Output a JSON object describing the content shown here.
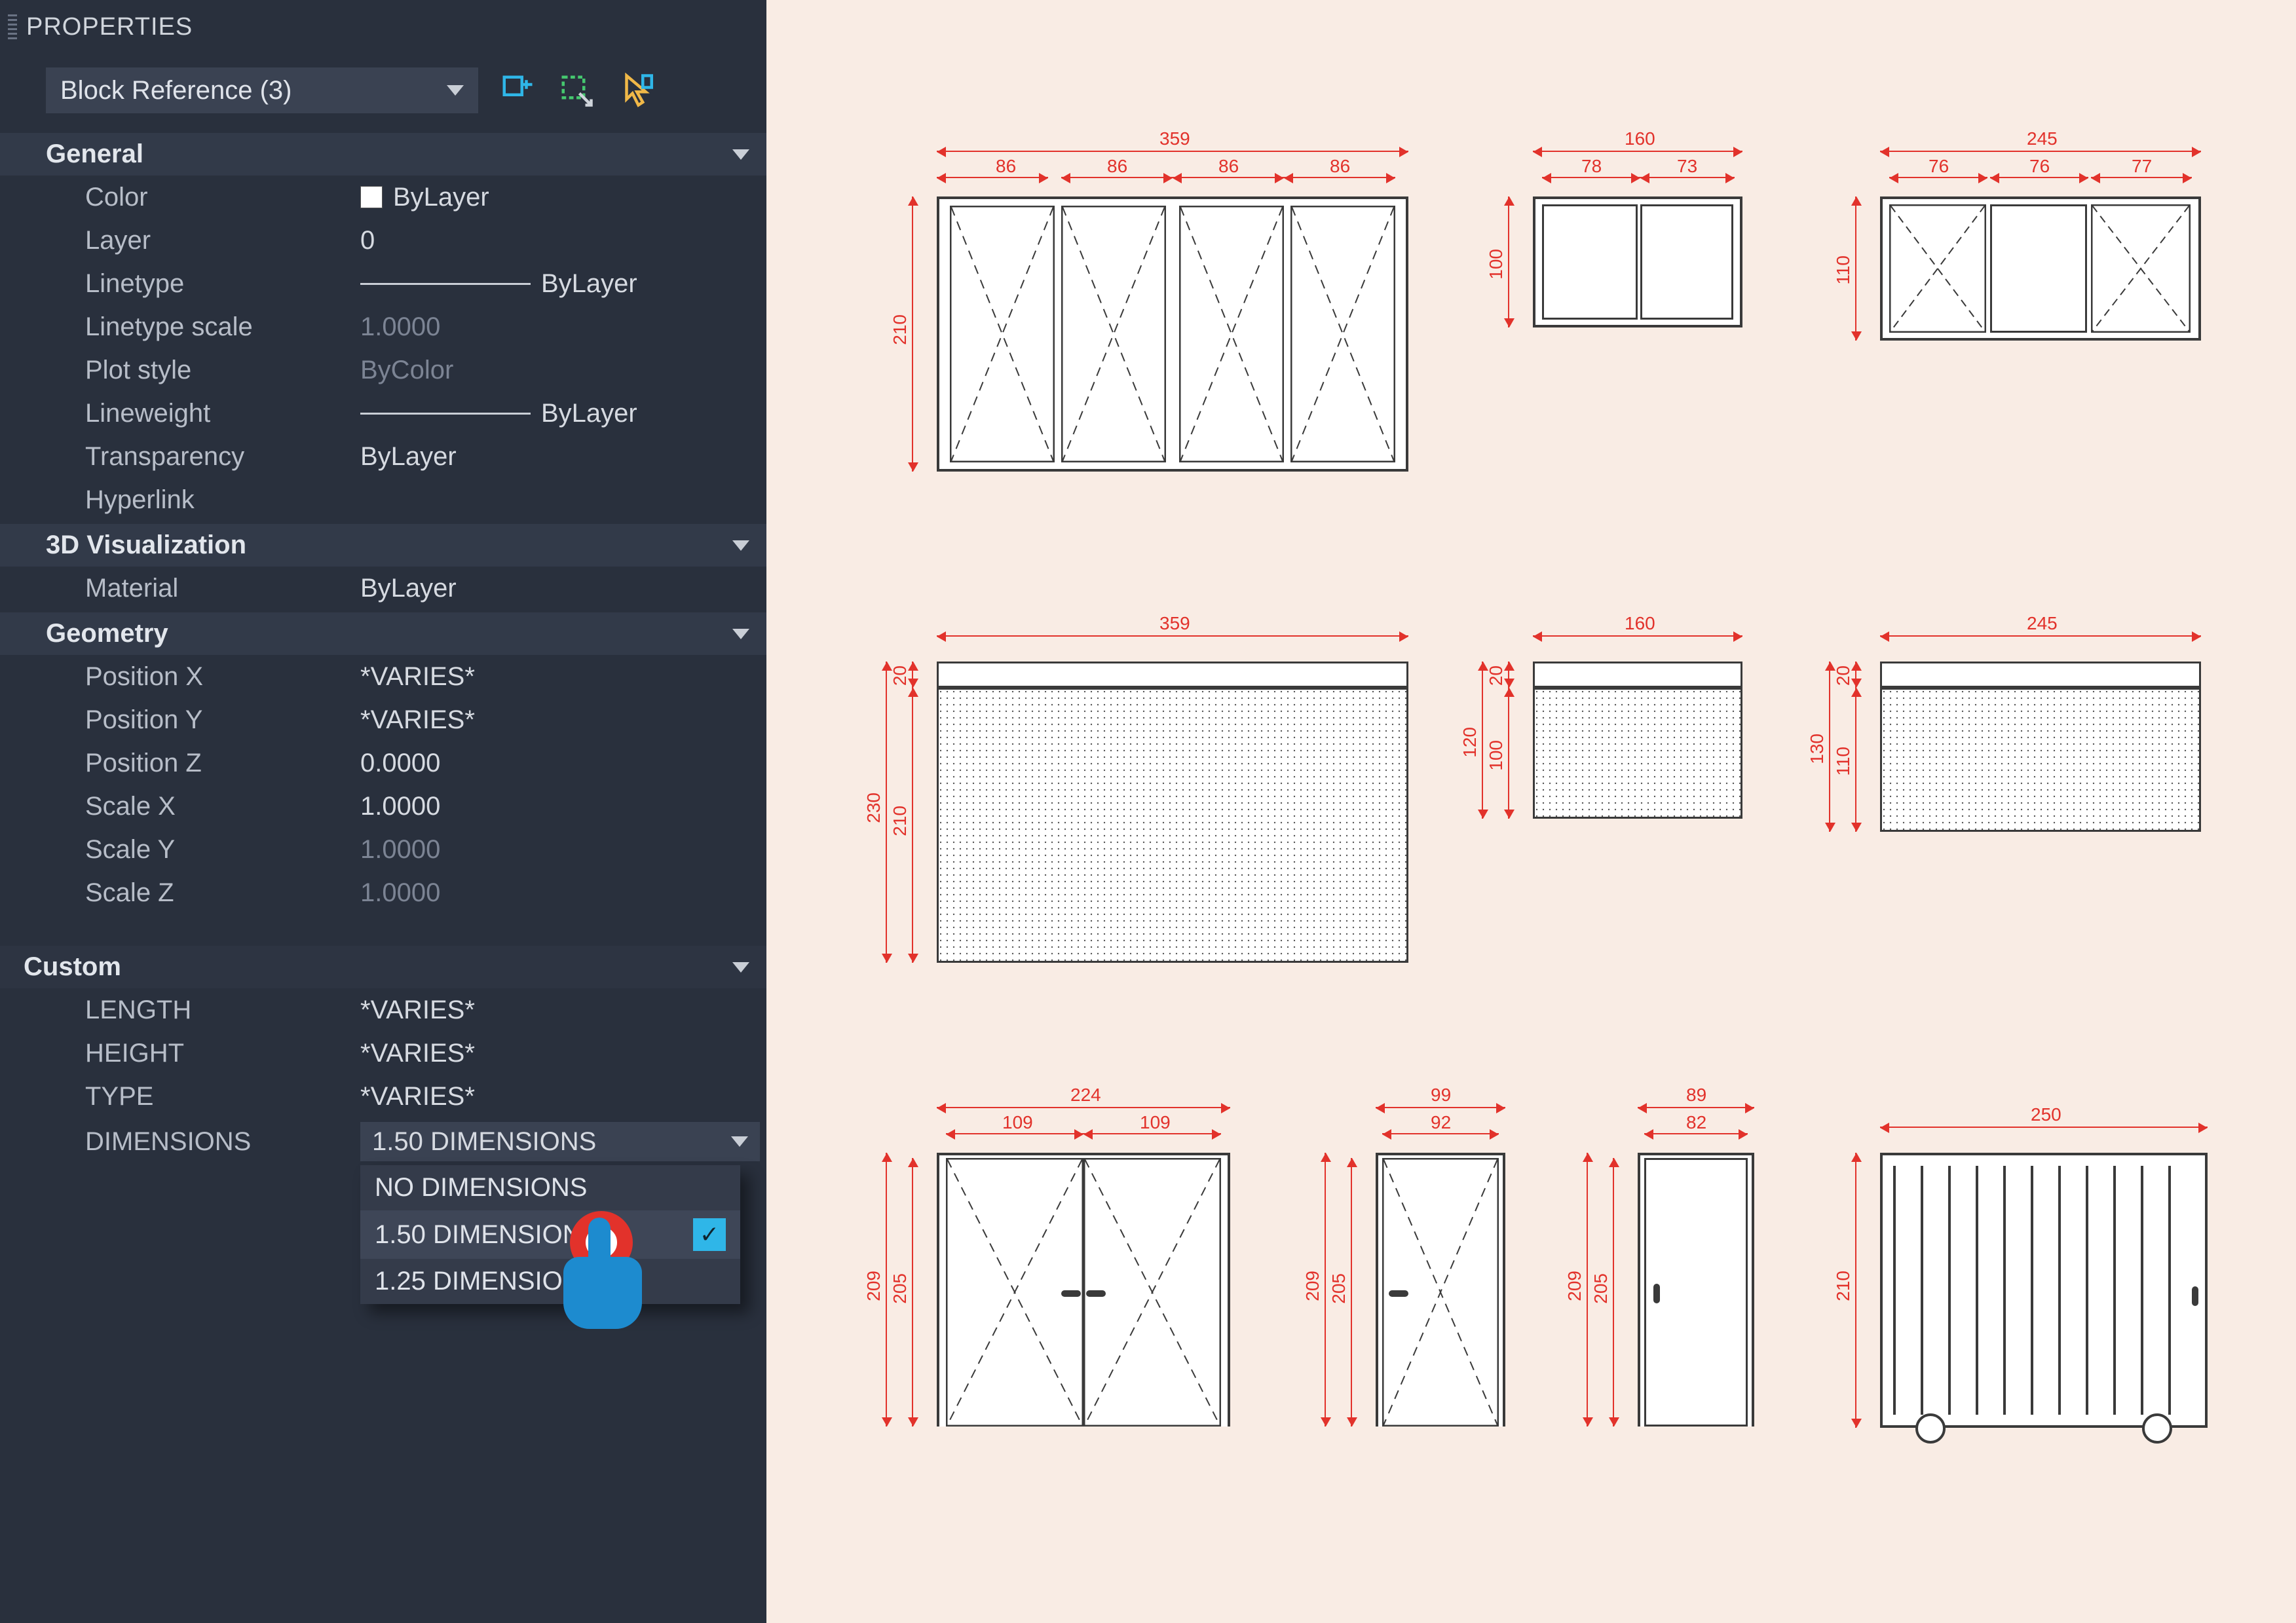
{
  "panel": {
    "title": "PROPERTIES",
    "selection": "Block Reference (3)",
    "sections": {
      "general": {
        "title": "General",
        "rows": {
          "color": {
            "label": "Color",
            "value": "ByLayer"
          },
          "layer": {
            "label": "Layer",
            "value": "0"
          },
          "linetype": {
            "label": "Linetype",
            "value": "ByLayer"
          },
          "ltscale": {
            "label": "Linetype scale",
            "value": "1.0000"
          },
          "plotstyle": {
            "label": "Plot style",
            "value": "ByColor"
          },
          "lineweight": {
            "label": "Lineweight",
            "value": "ByLayer"
          },
          "transparency": {
            "label": "Transparency",
            "value": "ByLayer"
          },
          "hyperlink": {
            "label": "Hyperlink",
            "value": ""
          }
        }
      },
      "vis3d": {
        "title": "3D Visualization",
        "rows": {
          "material": {
            "label": "Material",
            "value": "ByLayer"
          }
        }
      },
      "geometry": {
        "title": "Geometry",
        "rows": {
          "px": {
            "label": "Position X",
            "value": "*VARIES*"
          },
          "py": {
            "label": "Position Y",
            "value": "*VARIES*"
          },
          "pz": {
            "label": "Position Z",
            "value": "0.0000"
          },
          "sx": {
            "label": "Scale X",
            "value": "1.0000"
          },
          "sy": {
            "label": "Scale Y",
            "value": "1.0000"
          },
          "sz": {
            "label": "Scale Z",
            "value": "1.0000"
          }
        }
      },
      "custom": {
        "title": "Custom",
        "rows": {
          "length": {
            "label": "LENGTH",
            "value": "*VARIES*"
          },
          "height": {
            "label": "HEIGHT",
            "value": "*VARIES*"
          },
          "type": {
            "label": "TYPE",
            "value": "*VARIES*"
          },
          "dims": {
            "label": "DIMENSIONS",
            "value": "1.50 DIMENSIONS",
            "options": [
              "NO DIMENSIONS",
              "1.50 DIMENSIONS",
              "1.25 DIMENSIONS"
            ],
            "selected_index": 1
          }
        }
      }
    }
  },
  "canvas": {
    "row1": {
      "win4": {
        "total": "359",
        "subs": [
          "86",
          "86",
          "86",
          "86"
        ],
        "h": "210"
      },
      "win2": {
        "total": "160",
        "subs": [
          "78",
          "73"
        ],
        "h": "100"
      },
      "win3": {
        "total": "245",
        "subs": [
          "76",
          "76",
          "77"
        ],
        "h": "110"
      }
    },
    "row2": {
      "sh1": {
        "total": "359",
        "h_out": "230",
        "h_in": "210",
        "box": "20"
      },
      "sh2": {
        "total": "160",
        "h_out": "120",
        "h_in": "100",
        "box": "20"
      },
      "sh3": {
        "total": "245",
        "h_out": "130",
        "h_in": "110",
        "box": "20"
      }
    },
    "row3": {
      "dd": {
        "total": "224",
        "subs": [
          "109",
          "109"
        ],
        "h_out": "209",
        "h_in": "205"
      },
      "d1": {
        "total": "99",
        "subs": [
          "92"
        ],
        "h_out": "209",
        "h_in": "205"
      },
      "d2": {
        "total": "89",
        "subs": [
          "82"
        ],
        "h_out": "209",
        "h_in": "205"
      },
      "gate": {
        "total": "250",
        "h": "210"
      }
    }
  },
  "colors": {
    "dim": "#e2322b",
    "frame": "#3a3a3a",
    "panel": "#29303d",
    "accent": "#2fb6e8"
  }
}
